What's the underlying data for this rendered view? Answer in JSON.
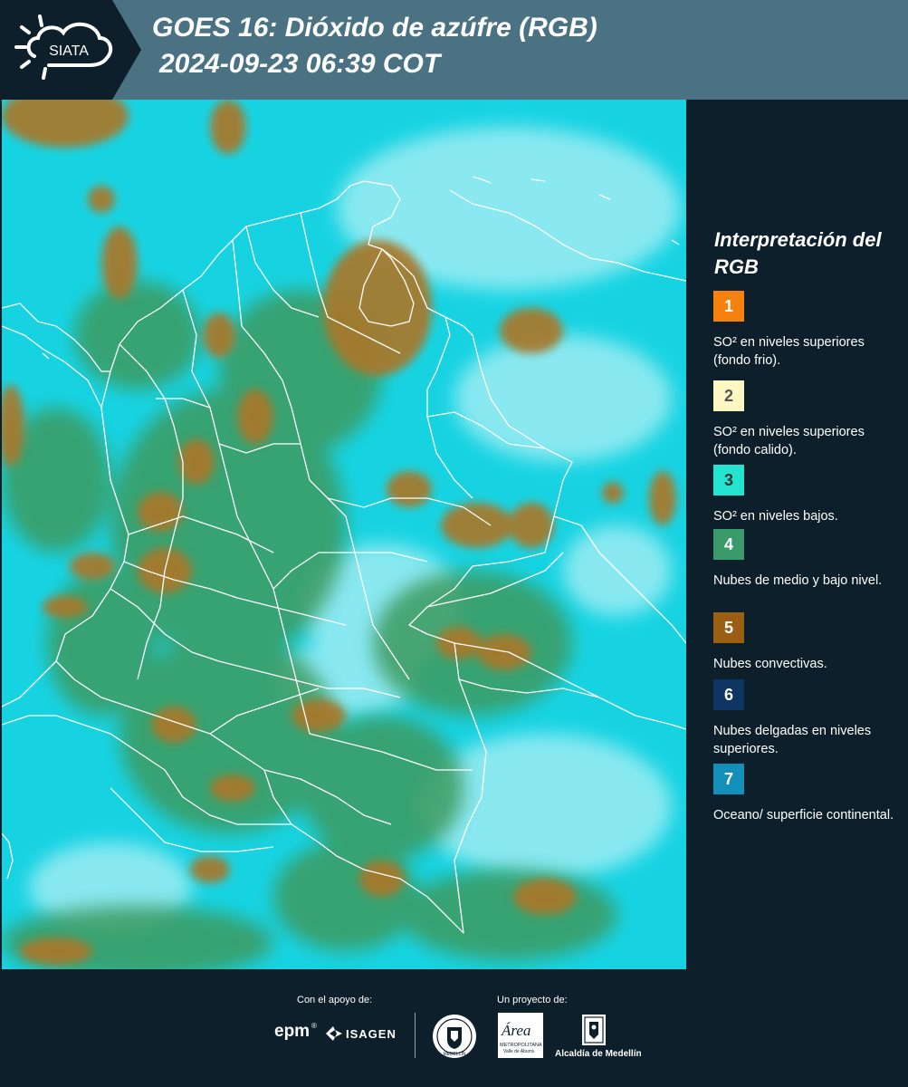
{
  "header": {
    "logo_text": "SIATA",
    "title_line1": "GOES 16: Dióxido de azúfre (RGB)",
    "title_line2": "2024-09-23 06:39 COT"
  },
  "legend": {
    "title": "Interpretación del RGB",
    "items": [
      {
        "number": "1",
        "label": "SO² en niveles superiores (fondo frio).",
        "color": "#f5820f",
        "number_color": "#ffffff"
      },
      {
        "number": "2",
        "label": "SO² en niveles superiores (fondo calido).",
        "color": "#fdf7c3",
        "number_color": "#555555"
      },
      {
        "number": "3",
        "label": "SO² en niveles bajos.",
        "color": "#22e4cf",
        "number_color": "#333333"
      },
      {
        "number": "4",
        "label": "Nubes de medio y bajo nivel.",
        "color": "#3b9a6b",
        "number_color": "#ffffff"
      },
      {
        "number": "5",
        "label": "Nubes convectivas.",
        "color": "#9a5f13",
        "number_color": "#ffffff"
      },
      {
        "number": "6",
        "label": "Nubes delgadas en niveles superiores.",
        "color": "#0f3563",
        "number_color": "#ffffff"
      },
      {
        "number": "7",
        "label": "Oceano/ superficie continental.",
        "color": "#1390b9",
        "number_color": "#ffffff"
      }
    ]
  },
  "footer": {
    "support_label": "Con el apoyo de:",
    "project_label": "Un proyecto de:",
    "epm_logo": "epm",
    "isagen_logo": "ISAGEN",
    "area_logo": "Área",
    "area_subtitle": "METROPOLITANA",
    "area_subtitle2": "Valle de Aburrá",
    "alcaldia_logo": "Alcaldía de Medellín",
    "seal_text": "MEDELLÍN"
  },
  "colors": {
    "header_band": "#4a7282",
    "background": "#0d1f2b",
    "sky_cyan": "#14d4e0",
    "cloud_green": "#3b9a6b",
    "cloud_orange": "#a8782b"
  }
}
